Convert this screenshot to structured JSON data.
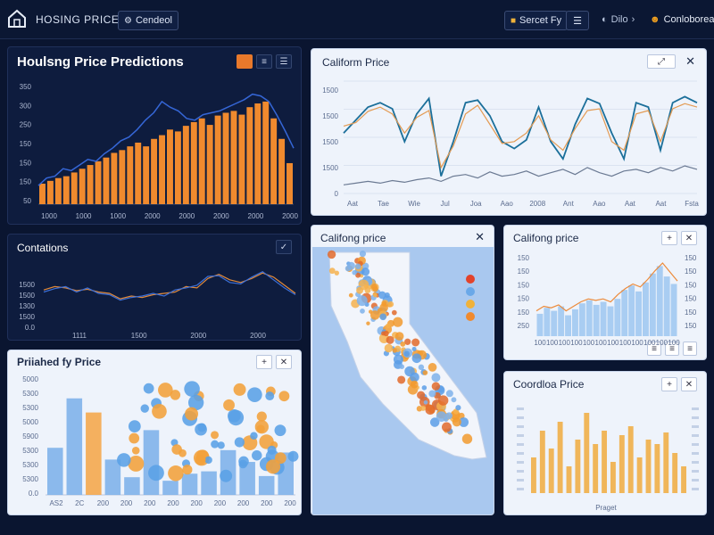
{
  "header": {
    "title": "HOSING PRICE",
    "filter_button": "Cendeol",
    "search_button": "Sercet Fy",
    "nav_label": "Dilo",
    "user_label": "Conloborea"
  },
  "panels": {
    "predictions": {
      "title": "Houlsng Price Predictions",
      "y_ticks": [
        "350",
        "300",
        "250",
        "150",
        "150",
        "150",
        "50"
      ],
      "x_ticks": [
        "1000",
        "1000",
        "1000",
        "2000",
        "2000",
        "2000",
        "2000",
        "2000"
      ]
    },
    "correlations": {
      "title": "Contations",
      "y_ticks": [
        "1500",
        "1500",
        "1300",
        "1500",
        "0.0"
      ],
      "x_ticks": [
        "1111",
        "1500",
        "2000",
        "2000"
      ]
    },
    "california_trend": {
      "title": "Caliform Price",
      "y_ticks": [
        "1500",
        "1500",
        "1500",
        "1500",
        "0"
      ],
      "x_ticks": [
        "Aat",
        "Tae",
        "Wie",
        "Jul",
        "Joa",
        "Aao",
        "2008",
        "Ant",
        "Aao",
        "Aat",
        "Aat",
        "Fsta"
      ]
    },
    "prices_by": {
      "title": "Priiahed fy Price",
      "y_ticks": [
        "5000",
        "5300",
        "5300",
        "5000",
        "5900",
        "5300",
        "5300",
        "5300",
        "0.0"
      ],
      "x_ticks": [
        "AS2",
        "2C",
        "200",
        "200",
        "200",
        "200",
        "200",
        "200",
        "200",
        "200",
        "200"
      ]
    },
    "map": {
      "title": "Califong price"
    },
    "ca_bars_top": {
      "title": "Califong price",
      "y_ticks_left": [
        "150",
        "150",
        "150",
        "150",
        "150",
        "250"
      ],
      "y_ticks_right": [
        "150",
        "150",
        "150",
        "150",
        "150",
        "150"
      ],
      "x_ticks": [
        "100",
        "100",
        "100",
        "100",
        "100",
        "100",
        "100",
        "100",
        "100",
        "100",
        "100",
        "100"
      ]
    },
    "ca_bars_bottom": {
      "title": "Coordloa Price",
      "x_caption": "Praget"
    }
  },
  "colors": {
    "orange": "#f08a2e",
    "blue": "#6aa8e8",
    "navy": "#0e1c3e",
    "accent": "#e8792b"
  },
  "chart_data": [
    {
      "type": "bar",
      "name_id": "predictions",
      "values": [
        22,
        25,
        28,
        30,
        34,
        38,
        42,
        46,
        50,
        55,
        58,
        62,
        66,
        62,
        70,
        74,
        80,
        78,
        84,
        88,
        92,
        85,
        95,
        98,
        100,
        96,
        104,
        108,
        110,
        92,
        70,
        44
      ],
      "overlay_line": [
        20,
        28,
        30,
        38,
        36,
        42,
        48,
        46,
        54,
        60,
        68,
        72,
        80,
        90,
        98,
        110,
        104,
        100,
        92,
        90,
        96,
        98,
        100,
        104,
        108,
        112,
        118,
        116,
        110,
        95,
        78,
        60
      ],
      "ylim": [
        0,
        130
      ]
    },
    {
      "type": "line",
      "name_id": "correlations",
      "series": [
        {
          "values": [
            55,
            60,
            58,
            54,
            56,
            52,
            50,
            42,
            46,
            44,
            48,
            50,
            52,
            60,
            58,
            72,
            78,
            70,
            66,
            72,
            80,
            74,
            62,
            50
          ]
        },
        {
          "values": [
            52,
            57,
            60,
            52,
            58,
            50,
            48,
            40,
            44,
            46,
            50,
            46,
            55,
            58,
            62,
            75,
            76,
            66,
            64,
            74,
            82,
            70,
            58,
            48
          ]
        }
      ],
      "ylim": [
        0,
        100
      ]
    },
    {
      "type": "line",
      "name_id": "california_trend",
      "series": [
        {
          "values": [
            70,
            85,
            100,
            105,
            98,
            60,
            92,
            110,
            20,
            60,
            105,
            108,
            90,
            60,
            52,
            62,
            100,
            60,
            40,
            80,
            110,
            104,
            70,
            40,
            105,
            100,
            50,
            105,
            112,
            105
          ]
        },
        {
          "values": [
            78,
            82,
            95,
            100,
            92,
            70,
            88,
            96,
            30,
            55,
            92,
            102,
            80,
            58,
            60,
            70,
            90,
            62,
            50,
            75,
            96,
            98,
            60,
            50,
            92,
            96,
            60,
            98,
            104,
            100
          ]
        },
        {
          "values": [
            10,
            12,
            14,
            12,
            15,
            13,
            16,
            18,
            14,
            20,
            22,
            18,
            25,
            20,
            22,
            26,
            20,
            24,
            28,
            22,
            30,
            24,
            20,
            26,
            28,
            24,
            30,
            26,
            32,
            28
          ]
        }
      ],
      "ylim": [
        0,
        130
      ]
    },
    {
      "type": "bar",
      "name_id": "prices_by",
      "values": [
        40,
        0,
        82,
        0,
        0,
        55,
        0,
        30,
        0,
        0,
        0,
        0,
        0,
        0,
        0,
        22,
        0,
        0
      ],
      "bars": [
        {
          "x": 0,
          "v": 40,
          "c": "blue"
        },
        {
          "x": 1,
          "v": 82,
          "c": "blue"
        },
        {
          "x": 2,
          "v": 70,
          "c": "orange"
        },
        {
          "x": 3,
          "v": 30,
          "c": "blue"
        },
        {
          "x": 4,
          "v": 15,
          "c": "blue"
        },
        {
          "x": 5,
          "v": 55,
          "c": "blue"
        },
        {
          "x": 6,
          "v": 12,
          "c": "blue"
        },
        {
          "x": 7,
          "v": 18,
          "c": "blue"
        },
        {
          "x": 8,
          "v": 20,
          "c": "blue"
        },
        {
          "x": 9,
          "v": 38,
          "c": "blue"
        },
        {
          "x": 10,
          "v": 28,
          "c": "blue"
        },
        {
          "x": 11,
          "v": 16,
          "c": "blue"
        },
        {
          "x": 12,
          "v": 36,
          "c": "blue"
        }
      ],
      "ylim": [
        0,
        100
      ]
    },
    {
      "type": "bar",
      "name_id": "ca_bars_top",
      "values": [
        30,
        38,
        34,
        40,
        28,
        36,
        44,
        48,
        42,
        46,
        40,
        50,
        62,
        68,
        60,
        72,
        84,
        94,
        80,
        70
      ],
      "overlay_line": [
        34,
        40,
        38,
        42,
        34,
        40,
        46,
        50,
        48,
        50,
        46,
        56,
        64,
        70,
        66,
        76,
        88,
        98,
        86,
        74
      ],
      "ylim": [
        0,
        110
      ]
    },
    {
      "type": "bar",
      "name_id": "ca_bars_bottom",
      "values": [
        40,
        70,
        50,
        80,
        30,
        60,
        90,
        55,
        70,
        35,
        65,
        75,
        40,
        60,
        55,
        68,
        45,
        30
      ],
      "ylim": [
        0,
        100
      ]
    }
  ]
}
